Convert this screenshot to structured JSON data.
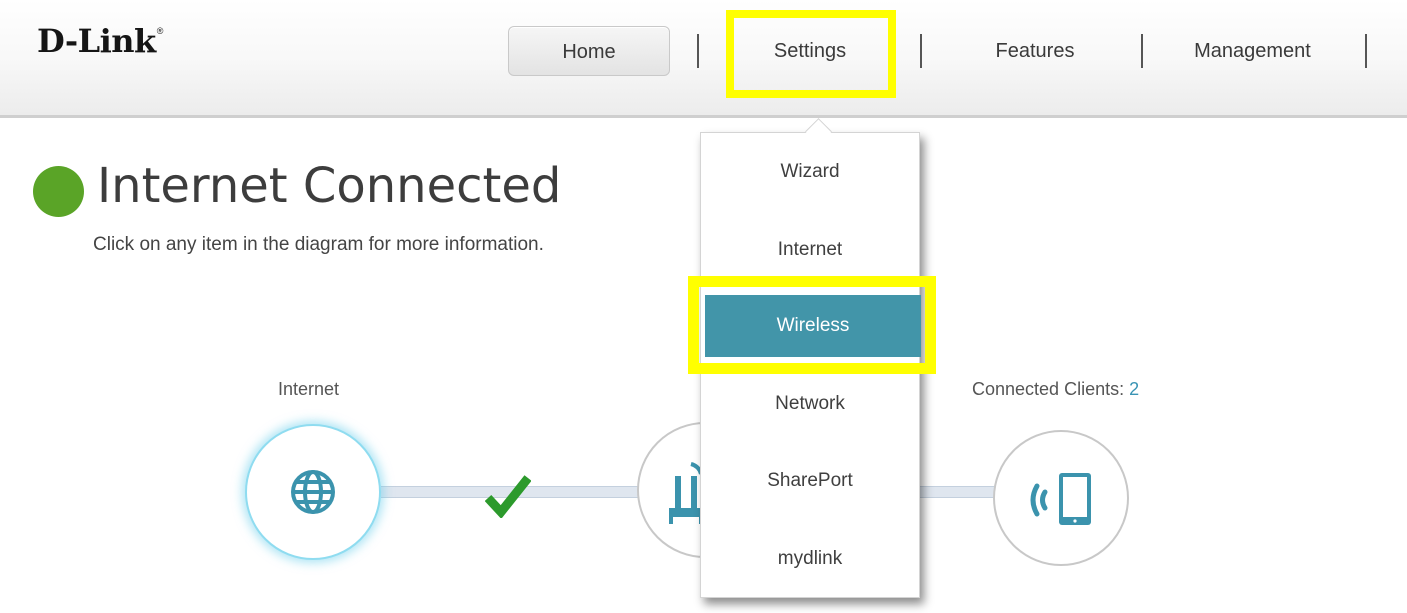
{
  "brand": {
    "logo_text": "D-Link",
    "logo_mark": "®"
  },
  "nav": {
    "home": "Home",
    "settings": "Settings",
    "features": "Features",
    "management": "Management"
  },
  "status": {
    "title": "Internet Connected",
    "hint": "Click on any item in the diagram for more information.",
    "color": "#5aa427"
  },
  "diagram": {
    "internet_label": "Internet",
    "clients_label": "Connected Clients: ",
    "clients_count": "2"
  },
  "settings_menu": {
    "items": [
      "Wizard",
      "Internet",
      "Wireless",
      "Network",
      "SharePort",
      "mydlink"
    ],
    "active": "Wireless"
  },
  "colors": {
    "accent": "#4295a9",
    "highlight": "#ffff00",
    "icon": "#3b93ad",
    "check": "#2c9a2c"
  },
  "icons": [
    "globe-icon",
    "check-icon",
    "router-icon",
    "wireless-tablet-icon"
  ]
}
